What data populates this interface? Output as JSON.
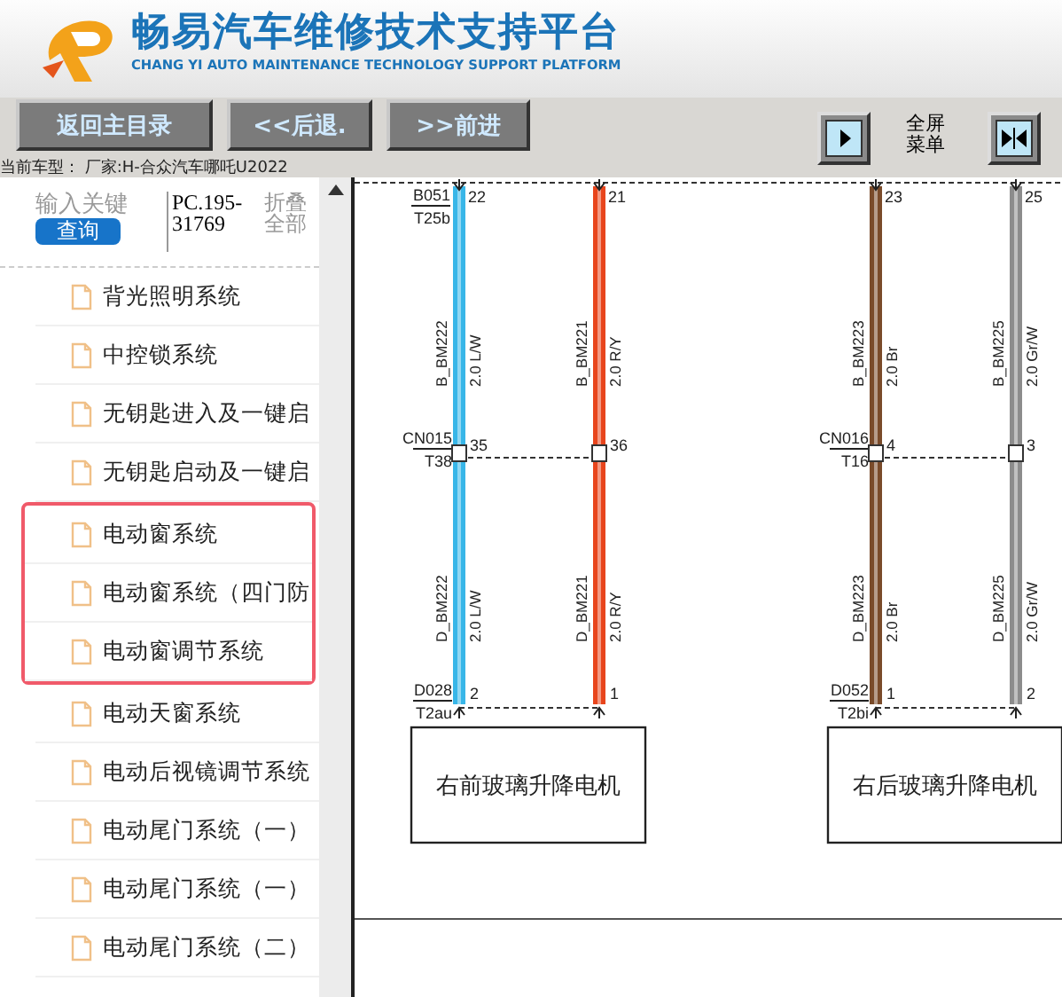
{
  "header": {
    "title": "畅易汽车维修技术支持平台",
    "subtitle": "CHANG YI AUTO MAINTENANCE TECHNOLOGY SUPPORT PLATFORM"
  },
  "toolbar": {
    "buttons": [
      "返回主目录",
      "<<后退.",
      ">>前进"
    ],
    "fullscreen_menu": "全屏菜单"
  },
  "status": "当前车型： 厂家:H-合众汽车哪吒U2022",
  "sidebar": {
    "search": {
      "placeholder": "输入关键",
      "button": "查询"
    },
    "code": "PC.195-31769",
    "collapse_all": "折叠全部",
    "items": [
      {
        "label": "背光照明系统",
        "highlighted": false
      },
      {
        "label": "中控锁系统",
        "highlighted": false
      },
      {
        "label": "无钥匙进入及一键启",
        "highlighted": false
      },
      {
        "label": "无钥匙启动及一键启",
        "highlighted": false
      },
      {
        "label": "电动窗系统",
        "highlighted": true
      },
      {
        "label": "电动窗系统（四门防",
        "highlighted": true
      },
      {
        "label": "电动窗调节系统",
        "highlighted": true
      },
      {
        "label": "电动天窗系统",
        "highlighted": false
      },
      {
        "label": "电动后视镜调节系统",
        "highlighted": false
      },
      {
        "label": "电动尾门系统（一）",
        "highlighted": false
      },
      {
        "label": "电动尾门系统（一）",
        "highlighted": false
      },
      {
        "label": "电动尾门系统（二）",
        "highlighted": false
      }
    ]
  },
  "diagram": {
    "circuits": [
      {
        "top": {
          "code": "B051",
          "terminal": "T25b"
        },
        "mid": {
          "code": "CN015",
          "terminal": "T38"
        },
        "bottom": {
          "code": "D028",
          "terminal": "T2au"
        },
        "motor": "右前玻璃升降电机",
        "wires": [
          {
            "color": "#38b6e8",
            "top_pin": "22",
            "upper_name": "B_BM222",
            "upper_spec": "2.0 L/W",
            "mid_pin": "35",
            "lower_name": "D_BM222",
            "lower_spec": "2.0 L/W",
            "bottom_pin": "2"
          },
          {
            "color": "#e8451c",
            "top_pin": "21",
            "upper_name": "B_BM221",
            "upper_spec": "2.0 R/Y",
            "mid_pin": "36",
            "lower_name": "D_BM221",
            "lower_spec": "2.0 R/Y",
            "bottom_pin": "1"
          }
        ]
      },
      {
        "mid": {
          "code": "CN016",
          "terminal": "T16"
        },
        "bottom": {
          "code": "D052",
          "terminal": "T2bi"
        },
        "motor": "右后玻璃升降电机",
        "wires": [
          {
            "color": "#7a4b2a",
            "top_pin": "23",
            "upper_name": "B_BM223",
            "upper_spec": "2.0 Br",
            "mid_pin": "4",
            "lower_name": "D_BM223",
            "lower_spec": "2.0 Br",
            "bottom_pin": "1"
          },
          {
            "color": "#8c8c8c",
            "top_pin": "25",
            "upper_name": "B_BM225",
            "upper_spec": "2.0 Gr/W",
            "mid_pin": "3",
            "lower_name": "D_BM225",
            "lower_spec": "2.0 Gr/W",
            "bottom_pin": "2"
          }
        ]
      }
    ]
  }
}
